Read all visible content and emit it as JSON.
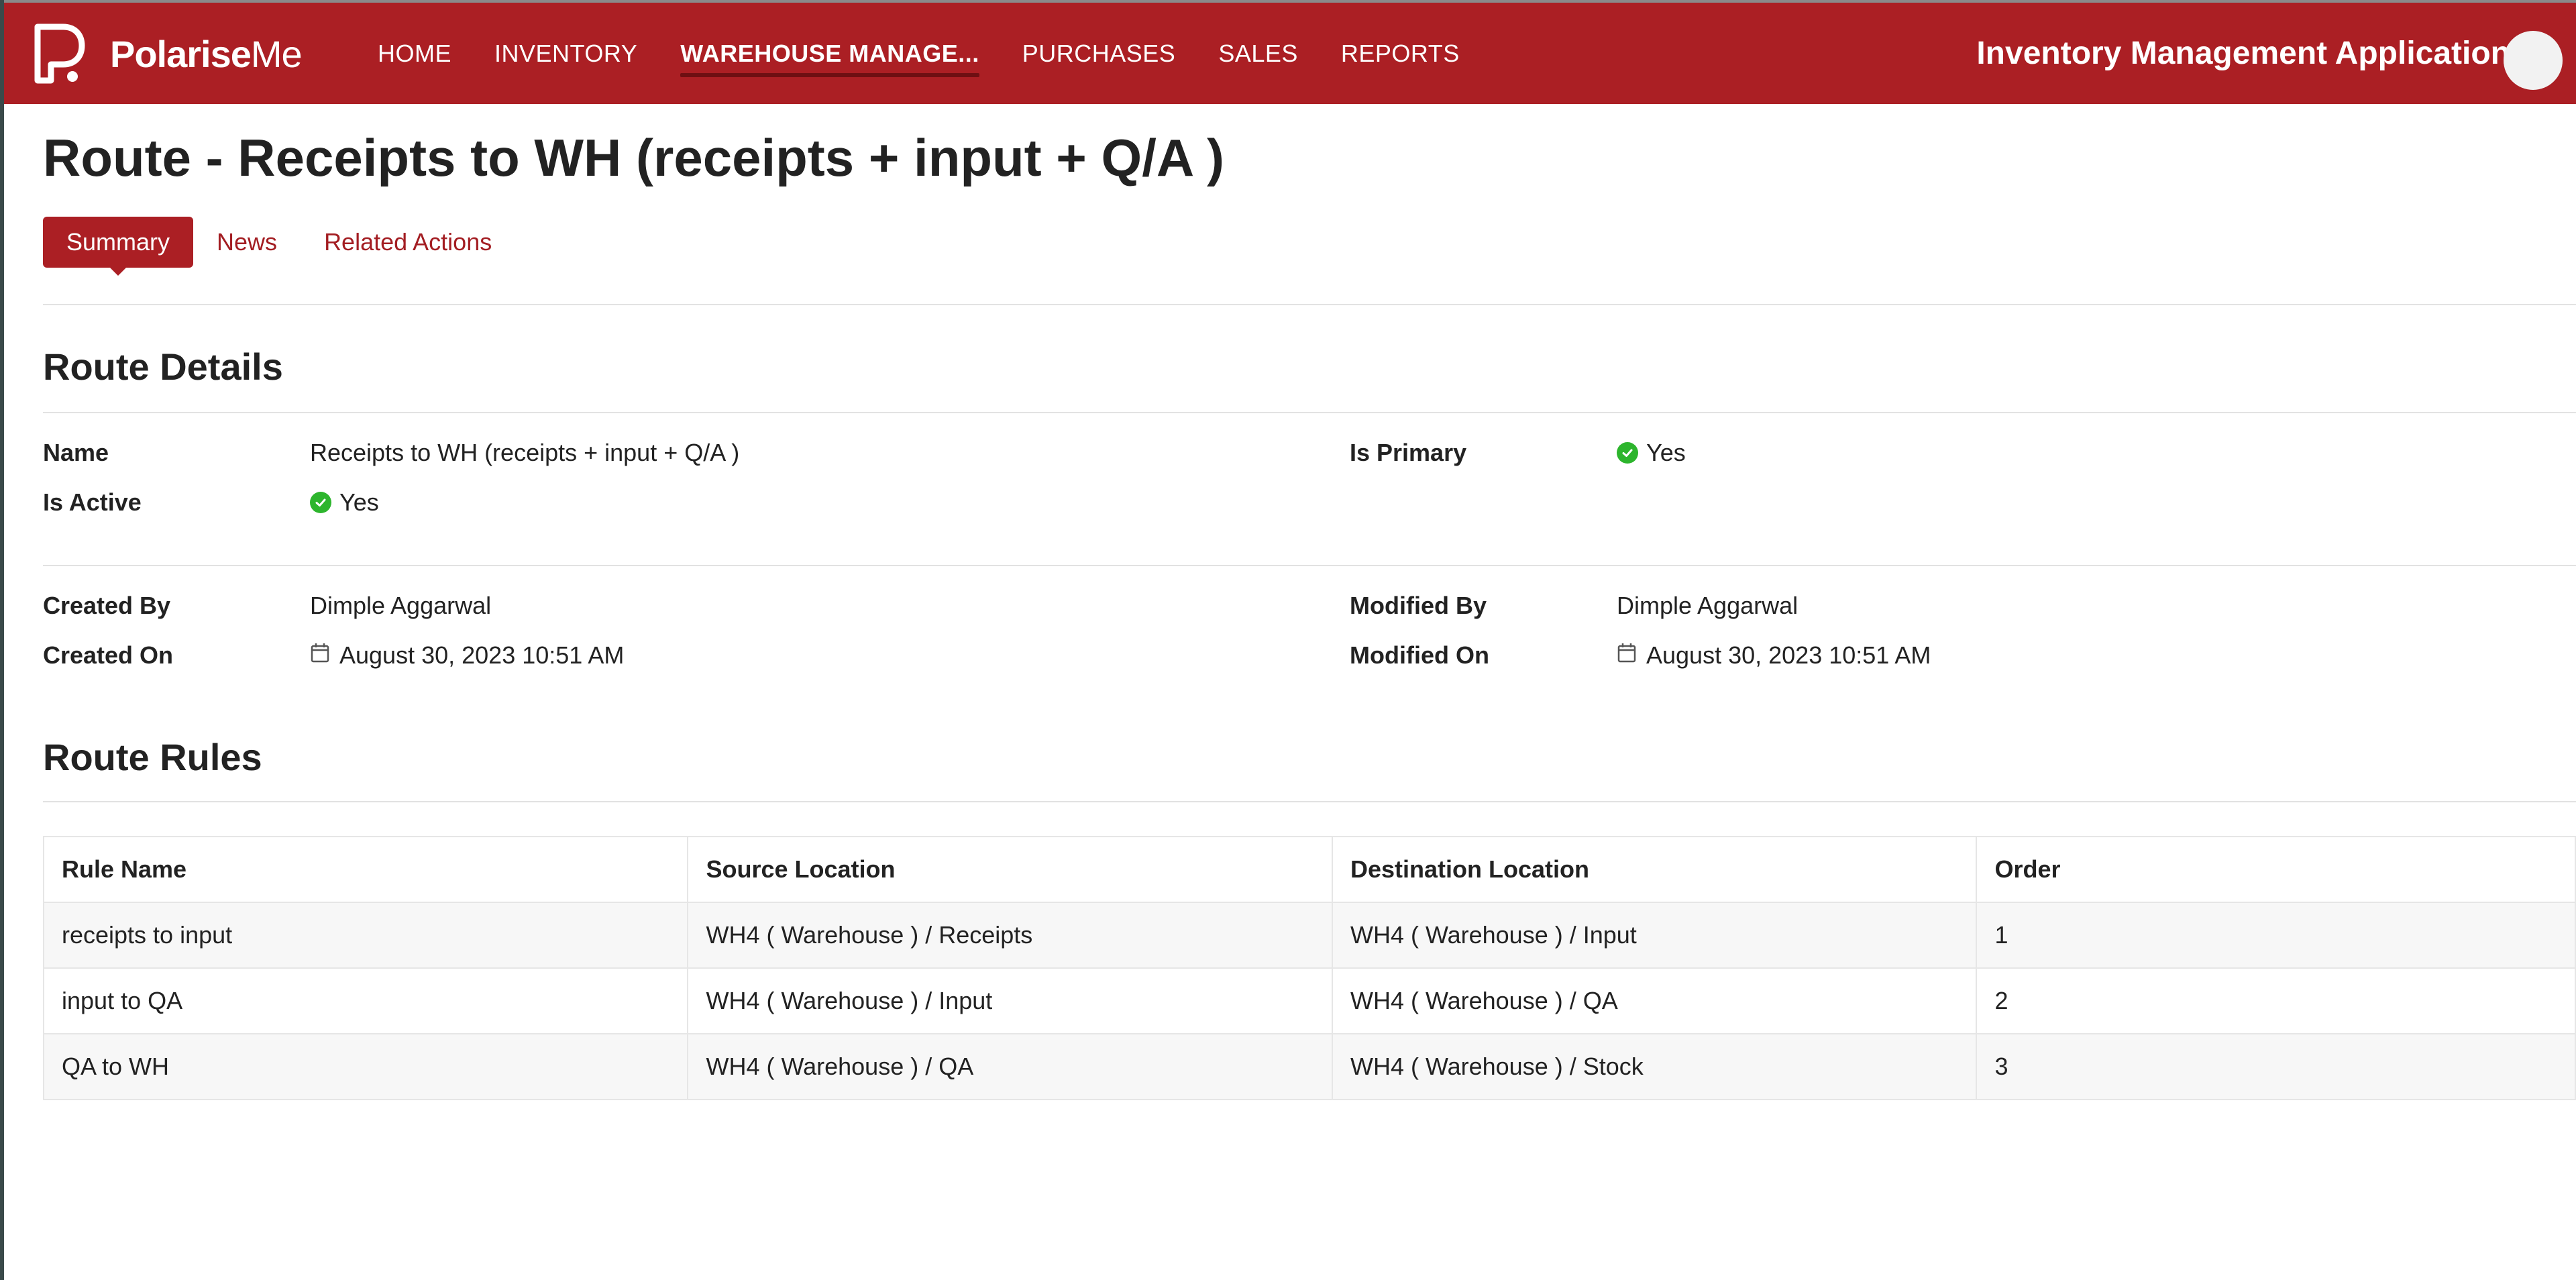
{
  "header": {
    "brand": {
      "part1": "Polarise",
      "part2": "Me"
    },
    "nav": [
      {
        "label": "HOME",
        "active": false
      },
      {
        "label": "INVENTORY",
        "active": false
      },
      {
        "label": "WAREHOUSE MANAGE...",
        "active": true
      },
      {
        "label": "PURCHASES",
        "active": false
      },
      {
        "label": "SALES",
        "active": false
      },
      {
        "label": "REPORTS",
        "active": false
      }
    ],
    "app_menu_label": "Inventory Management Application"
  },
  "page": {
    "title": "Route - Receipts to WH (receipts + input + Q/A )",
    "tabs": [
      {
        "label": "Summary",
        "active": true
      },
      {
        "label": "News",
        "active": false
      },
      {
        "label": "Related Actions",
        "active": false
      }
    ]
  },
  "route_details": {
    "section_title": "Route Details",
    "name_label": "Name",
    "name_value": "Receipts to WH (receipts + input + Q/A )",
    "is_primary_label": "Is Primary",
    "is_primary_value": "Yes",
    "is_active_label": "Is Active",
    "is_active_value": "Yes",
    "created_by_label": "Created By",
    "created_by_value": "Dimple Aggarwal",
    "modified_by_label": "Modified By",
    "modified_by_value": "Dimple Aggarwal",
    "created_on_label": "Created On",
    "created_on_value": "August 30, 2023 10:51 AM",
    "modified_on_label": "Modified On",
    "modified_on_value": "August 30, 2023 10:51 AM"
  },
  "route_rules": {
    "section_title": "Route Rules",
    "columns": [
      "Rule Name",
      "Source Location",
      "Destination Location",
      "Order"
    ],
    "rows": [
      [
        "receipts to input",
        "WH4 ( Warehouse ) / Receipts",
        "WH4 ( Warehouse ) / Input",
        "1"
      ],
      [
        "input to QA",
        "WH4 ( Warehouse ) / Input",
        "WH4 ( Warehouse ) / QA",
        "2"
      ],
      [
        "QA to WH",
        "WH4 ( Warehouse ) / QA",
        "WH4 ( Warehouse ) / Stock",
        "3"
      ]
    ]
  },
  "colors": {
    "brand_red": "#ab1f24",
    "tab_text": "#a31d22",
    "check_green": "#2db52d"
  },
  "icons": [
    "logo-icon",
    "check-circle-icon",
    "calendar-icon",
    "caret-down-icon"
  ]
}
